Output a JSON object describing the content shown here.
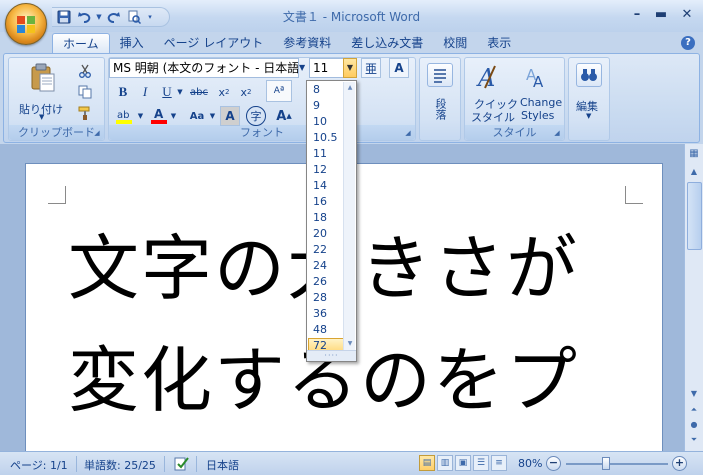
{
  "window": {
    "title": "文書１ - Microsoft Word"
  },
  "tabs": [
    "ホーム",
    "挿入",
    "ページ レイアウト",
    "参考資料",
    "差し込み文書",
    "校閲",
    "表示"
  ],
  "active_tab": "ホーム",
  "ribbon": {
    "clipboard": {
      "label": "クリップボード",
      "paste_label": "貼り付け"
    },
    "font": {
      "label": "フォント",
      "font_name": "MS 明朝 (本文のフォント - 日本語)",
      "font_size": "11"
    },
    "paragraph": {
      "label": "段落"
    },
    "styles": {
      "label": "スタイル",
      "quick_style_line1": "クイック",
      "quick_style_line2": "スタイル",
      "change_line1": "Change",
      "change_line2": "Styles"
    },
    "editing": {
      "label": "編集"
    }
  },
  "font_size_dropdown": {
    "options": [
      "8",
      "9",
      "10",
      "10.5",
      "11",
      "12",
      "14",
      "16",
      "18",
      "20",
      "22",
      "24",
      "26",
      "28",
      "36",
      "48",
      "72"
    ],
    "highlighted": "72"
  },
  "document": {
    "lines": [
      "文字の大きさが",
      "変化するのをプ"
    ]
  },
  "status_bar": {
    "page": "ページ: 1/1",
    "words": "単語数: 25/25",
    "language": "日本語",
    "zoom": "80%",
    "zoom_level": 0.8
  },
  "colors": {
    "highlight": "#ffff00",
    "font_color": "#ff0000",
    "accent": "#15428b"
  }
}
